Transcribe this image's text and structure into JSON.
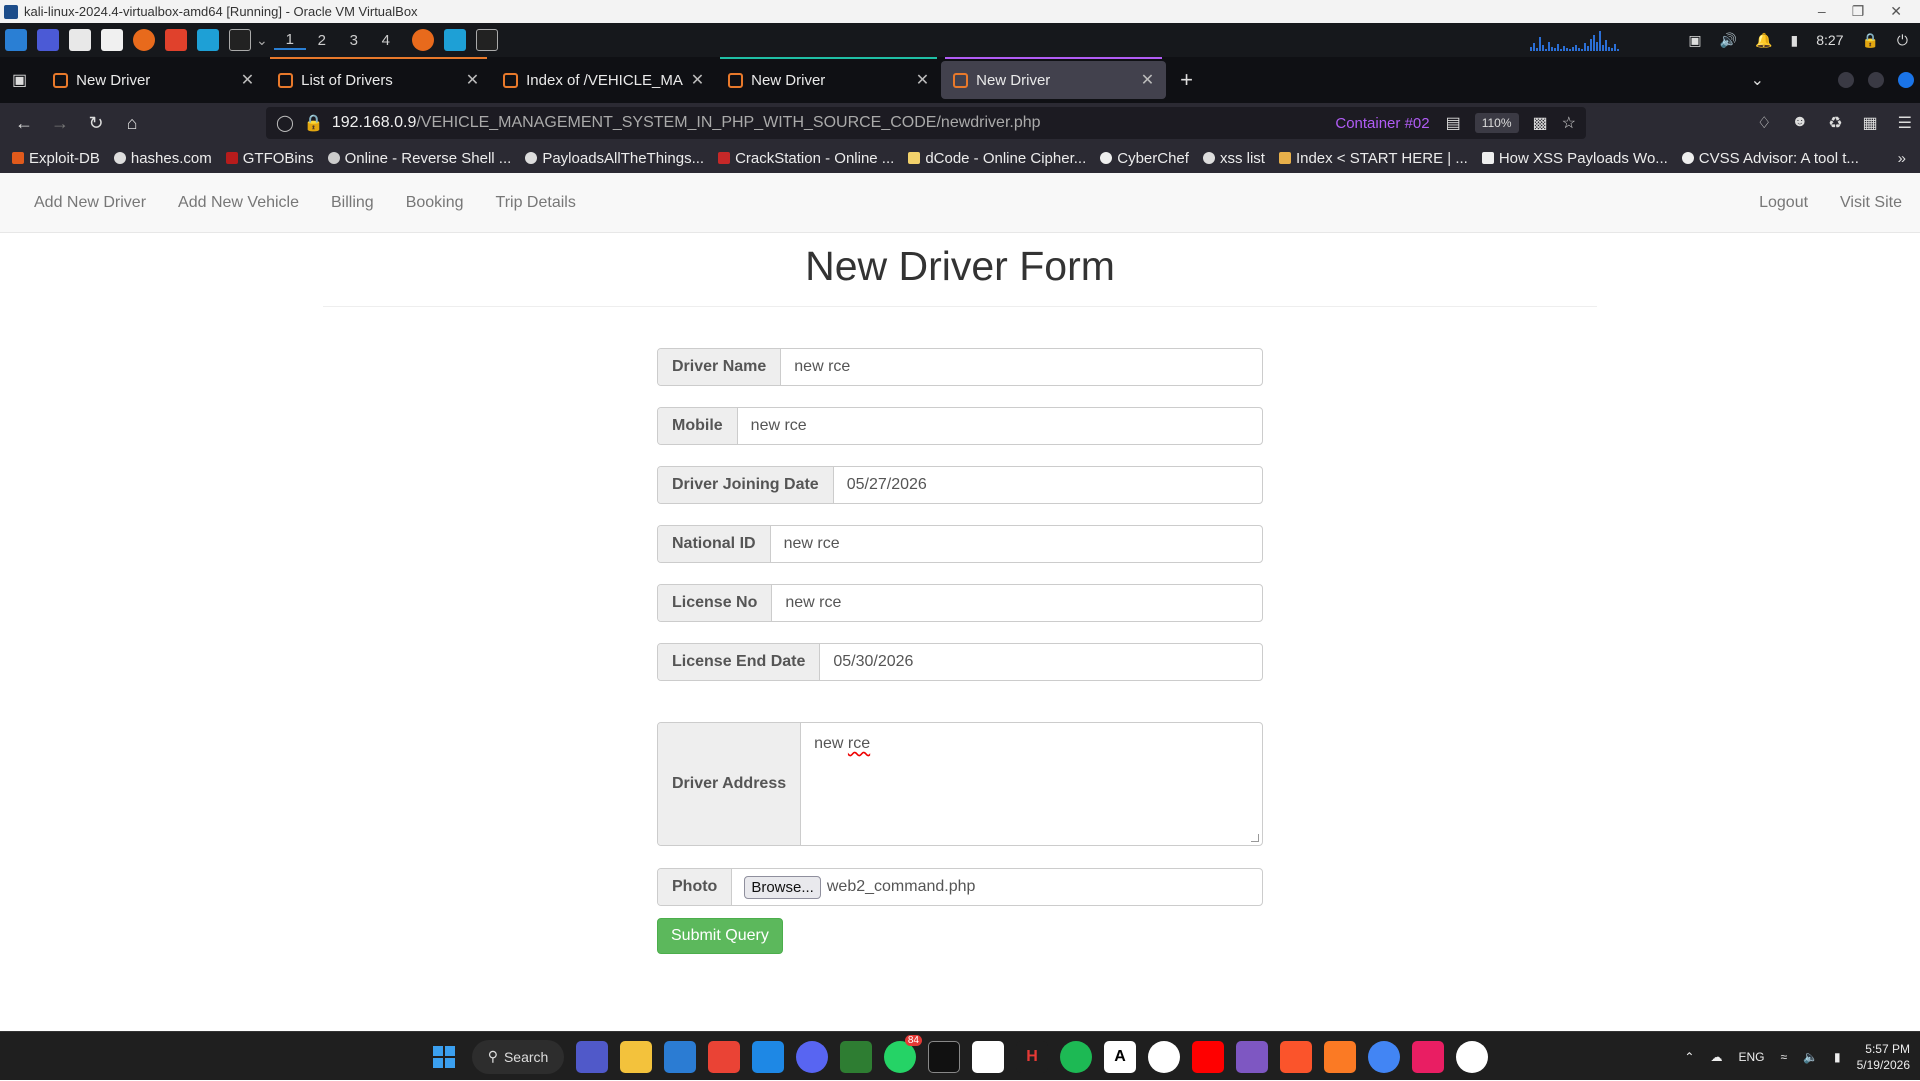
{
  "vbox": {
    "title": "kali-linux-2024.4-virtualbox-amd64 [Running] - Oracle VM VirtualBox"
  },
  "kali": {
    "workspaces": [
      "1",
      "2",
      "3",
      "4"
    ],
    "time": "8:27"
  },
  "firefox": {
    "tabs": [
      {
        "label": "New Driver",
        "active": false
      },
      {
        "label": "List of Drivers",
        "active": false
      },
      {
        "label": "Index of /VEHICLE_MANA",
        "active": false
      },
      {
        "label": "New Driver",
        "active": false
      },
      {
        "label": "New Driver",
        "active": true
      }
    ],
    "url_host": "192.168.0.9",
    "url_path": "/VEHICLE_MANAGEMENT_SYSTEM_IN_PHP_WITH_SOURCE_CODE/newdriver.php",
    "container": "Container #02",
    "zoom": "110%",
    "bookmarks": [
      "Exploit-DB",
      "hashes.com",
      "GTFOBins",
      "Online - Reverse Shell ...",
      "PayloadsAllTheThings...",
      "CrackStation - Online ...",
      "dCode - Online Cipher...",
      "CyberChef",
      "xss list",
      "Index < START HERE | ...",
      "How XSS Payloads Wo...",
      "CVSS Advisor: A tool t..."
    ]
  },
  "site": {
    "nav_left": [
      "Add New Driver",
      "Add New Vehicle",
      "Billing",
      "Booking",
      "Trip Details"
    ],
    "nav_right": [
      "Logout",
      "Visit Site"
    ],
    "form_title": "New Driver Form",
    "fields": [
      {
        "label": "Driver Name",
        "value": "new rce"
      },
      {
        "label": "Mobile",
        "value": "new rce"
      },
      {
        "label": "Driver Joining Date",
        "value": "05/27/2026"
      },
      {
        "label": "National ID",
        "value": "new rce"
      },
      {
        "label": "License No",
        "value": "new rce"
      },
      {
        "label": "License End Date",
        "value": "05/30/2026"
      }
    ],
    "address": {
      "label": "Driver Address",
      "value_a": "new ",
      "value_b": "rce"
    },
    "photo": {
      "label": "Photo",
      "browse": "Browse...",
      "filename": "web2_command.php"
    },
    "submit": "Submit Query"
  },
  "taskbar": {
    "search": "Search",
    "badge": "84",
    "lang": "ENG",
    "time": "5:57 PM",
    "date": "5/19/2026"
  }
}
